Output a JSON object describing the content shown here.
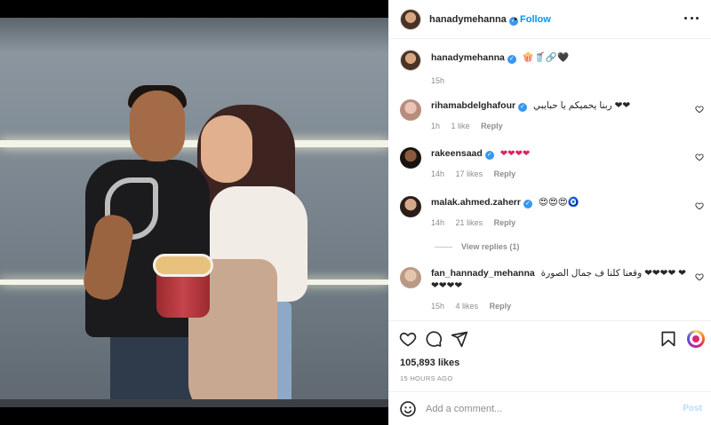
{
  "post": {
    "author": "hanadymehanna",
    "follow_label": "Follow",
    "dot": "•",
    "caption": "🍿🥤🔗🖤",
    "caption_time": "15h"
  },
  "comments": [
    {
      "user": "rihamabdelghafour",
      "verified": true,
      "text": "ربنا يحميكم يا حبايبي ❤❤",
      "time": "1h",
      "likes": "1 like",
      "reply": "Reply"
    },
    {
      "user": "rakeensaad",
      "verified": true,
      "text": "❤❤❤❤",
      "time": "14h",
      "likes": "17 likes",
      "reply": "Reply"
    },
    {
      "user": "malak.ahmed.zaherr",
      "verified": true,
      "text": "😍😍😍🧿",
      "time": "14h",
      "likes": "21 likes",
      "reply": "Reply",
      "view_replies": "View replies (1)"
    },
    {
      "user": "fan_hannady_mehanna",
      "verified": false,
      "text": "وقعنا كلنا ف جمال الصورة ❤❤❤❤ ❤❤❤❤❤",
      "time": "15h",
      "likes": "4 likes",
      "reply": "Reply"
    }
  ],
  "actions": {
    "likes_count": "105,893 likes",
    "date": "15 HOURS AGO"
  },
  "add_comment": {
    "placeholder": "Add a comment...",
    "post_label": "Post"
  },
  "icons": [
    "more-icon",
    "verified-badge-icon",
    "heart-icon",
    "comment-icon",
    "share-icon",
    "bookmark-icon",
    "emoji-icon"
  ],
  "colors": {
    "accent": "#0095f6",
    "heart": "#e0245e",
    "post_disabled": "#b2dffc"
  }
}
